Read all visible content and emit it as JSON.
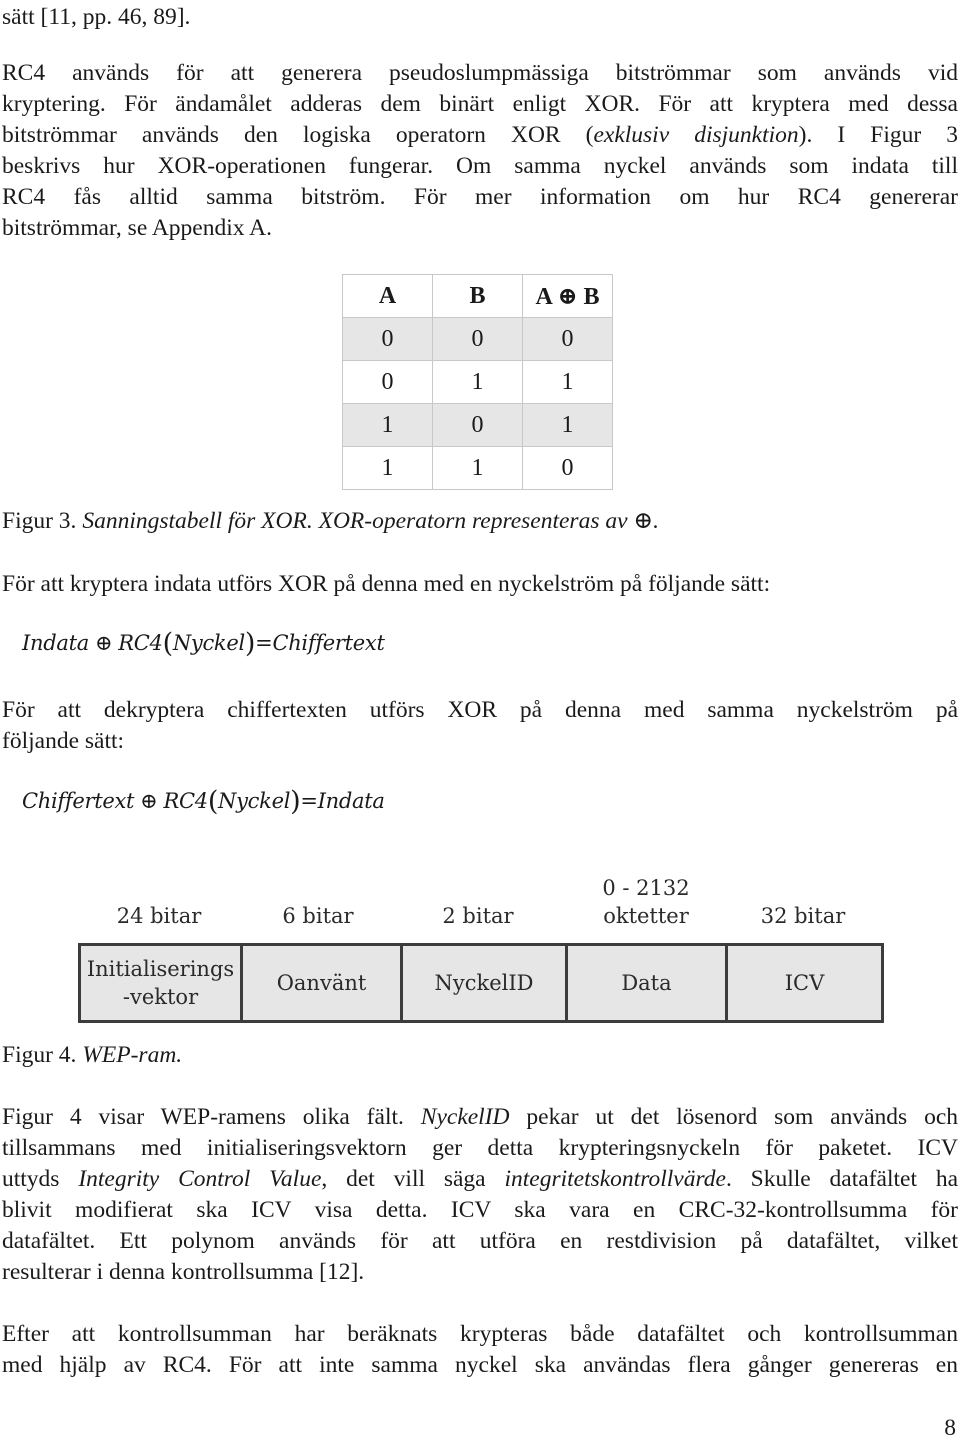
{
  "page": {
    "number": "8",
    "intro_line": "sätt [11, pp. 46, 89].",
    "paragraph1": {
      "lines": [
        "RC4 används för att generera pseudoslumpmässiga bitströmmar som används vid",
        "kryptering. För ändamålet adderas dem binärt enligt XOR. För att kryptera med dessa",
        [
          "bitströmmar används den logiska operatorn XOR (",
          "exklusiv disjunktion",
          "). I Figur 3"
        ],
        "beskrivs hur XOR-operationen fungerar. Om samma nyckel används som indata till",
        "RC4 fås alltid samma bitström. För mer information om hur RC4 genererar",
        "bitströmmar, se Appendix A."
      ]
    },
    "figure3": {
      "table": {
        "headers": [
          "A",
          "B",
          "A ⊕ B"
        ],
        "rows": [
          [
            "0",
            "0",
            "0"
          ],
          [
            "0",
            "1",
            "1"
          ],
          [
            "1",
            "0",
            "1"
          ],
          [
            "1",
            "1",
            "0"
          ]
        ],
        "row_shading": [
          "shaded",
          "plain",
          "shaded",
          "plain"
        ]
      },
      "caption_label": "Figur 3.",
      "caption_text": "Sanningstabell för XOR. XOR-operatorn representeras av ⊕."
    },
    "paragraph2": "För att kryptera indata utförs XOR på denna med en nyckelström på följande sätt:",
    "formula1": {
      "left": "Indata",
      "op": "⊕",
      "func": "RC4",
      "arg": "Nyckel",
      "eq": "=",
      "result": "Chiffertext"
    },
    "paragraph3": {
      "lines": [
        "För att dekryptera chiffertexten utförs XOR på denna med samma nyckelström på",
        "följande sätt:"
      ]
    },
    "formula2": {
      "left": "Chiffertext",
      "op": "⊕",
      "func": "RC4",
      "arg": "Nyckel",
      "eq": "=",
      "result": "Indata"
    },
    "figure4": {
      "fields": [
        {
          "size": "24 bitar",
          "name": "Initialiserings\n-vektor"
        },
        {
          "size": "6 bitar",
          "name": "Oanvänt"
        },
        {
          "size": "2 bitar",
          "name": "NyckelID"
        },
        {
          "size": "0 - 2132\noktetter",
          "name": "Data"
        },
        {
          "size": "32 bitar",
          "name": "ICV"
        }
      ],
      "fill_color": "#e6e6e6",
      "border_color": "#3c3c3c",
      "caption_label": "Figur 4.",
      "caption_text": "WEP-ram."
    },
    "paragraph4": {
      "lines": [
        [
          "Figur 4 visar WEP-ramens olika fält. ",
          "NyckelID",
          " pekar ut det lösenord som används och"
        ],
        "tillsammans med initialiseringsvektorn ger detta krypteringsnyckeln för paketet. ICV",
        [
          "uttyds ",
          "Integrity Control Value",
          ", det vill säga ",
          "integritetskontrollvärde",
          ". Skulle datafältet ha"
        ],
        "blivit modifierat ska ICV visa detta. ICV ska vara en CRC-32-kontrollsumma för",
        "datafältet. Ett polynom används för att utföra en restdivision på datafältet, vilket",
        "resulterar i denna kontrollsumma [12]."
      ]
    },
    "paragraph5": {
      "lines": [
        "Efter att kontrollsumman har beräknats krypteras både datafältet och kontrollsumman",
        "med hjälp av RC4. För att inte samma nyckel ska användas flera gånger genereras en"
      ]
    }
  }
}
